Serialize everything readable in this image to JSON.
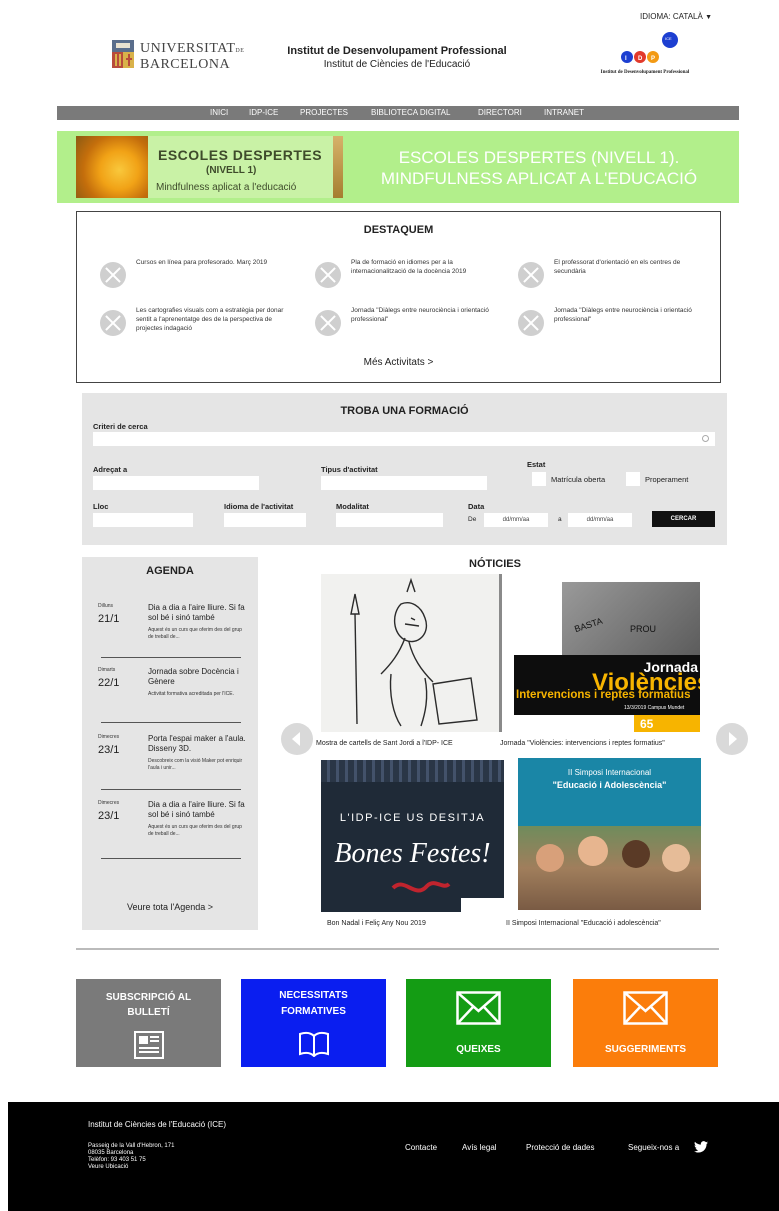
{
  "header": {
    "language": "IDIOMA: CATALÀ",
    "ub_logo": {
      "line1": "UNIVERSITAT",
      "line1_suffix": "DE",
      "line2": "BARCELONA"
    },
    "institute_title": "Institut de Desenvolupament Professional",
    "institute_subtitle": "Institut de Ciències de l'Educació",
    "idp_logo": {
      "letters": [
        "I",
        "D",
        "P"
      ],
      "badge": "ICE",
      "caption": "Institut de Desenvolupament Professional"
    }
  },
  "nav": {
    "items": [
      {
        "label": "INICI"
      },
      {
        "label": "IDP-ICE"
      },
      {
        "label": "PROJECTES"
      },
      {
        "label": "BIBLIOTECA DIGITAL"
      },
      {
        "label": "DIRECTORI"
      },
      {
        "label": "INTRANET"
      }
    ]
  },
  "banner": {
    "image_title": "ESCOLES DESPERTES",
    "image_level": "(NIVELL 1)",
    "image_subtitle": "Mindfulness aplicat a l'educació",
    "title_line1": "ESCOLES DESPERTES (NIVELL 1).",
    "title_line2": "MINDFULNESS APLICAT A L'EDUCACIÓ"
  },
  "featured": {
    "title": "DESTAQUEM",
    "items": [
      {
        "text": "Cursos en línea para profesorado. Març 2019"
      },
      {
        "text": "Pla de formació en idiomes per a la internacionalització de la docència 2019"
      },
      {
        "text": "El professorat d'orientació en els centres de secundària"
      },
      {
        "text": "Les cartografies visuals com a estratègia per donar sentit a l'aprenentatge des de la perspectiva de projectes indagació"
      },
      {
        "text": "Jornada \"Diàlegs entre neurociència i orientació professional\""
      },
      {
        "text": "Jornada \"Diàlegs entre neurociència i orientació professional\""
      }
    ],
    "more": "Més Activitats >"
  },
  "search": {
    "title": "TROBA UNA FORMACIÓ",
    "criteria_label": "Criteri de cerca",
    "addressed_label": "Adreçat a",
    "activity_type_label": "Tipus d'activitat",
    "status_label": "Estat",
    "status_options": [
      "Matrícula oberta",
      "Properament"
    ],
    "place_label": "Lloc",
    "language_label": "Idioma de l'activitat",
    "modality_label": "Modalitat",
    "date_label": "Data",
    "from_label": "De",
    "to_label": "a",
    "date_placeholder": "dd/mm/aa",
    "button": "CERCAR"
  },
  "agenda": {
    "title": "AGENDA",
    "events": [
      {
        "weekday": "Dilluns",
        "date": "21/1",
        "title": "Dia a dia a l'aire lliure. Si fa sol bé i sinó també",
        "desc": "Aquest és un curs que oferim des del grup de treball de..."
      },
      {
        "weekday": "Dimarts",
        "date": "22/1",
        "title": "Jornada sobre Docència i Gènere",
        "desc": "Activitat formativa acreditada per l'ICE."
      },
      {
        "weekday": "Dimecres",
        "date": "23/1",
        "title": "Porta l'espai maker a l'aula. Disseny 3D.",
        "desc": "Descobreix com la visió Maker pot enriquir l'aula i unir..."
      },
      {
        "weekday": "Dimecres",
        "date": "23/1",
        "title": "Dia a dia a l'aire lliure. Si fa sol bé i sinó també",
        "desc": "Aquest és un curs que oferim des del grup de treball de..."
      }
    ],
    "more": "Veure tota l'Agenda >"
  },
  "news": {
    "title": "NÓTICIES",
    "items": [
      {
        "caption": "Mostra de cartells de Sant Jordi a l'IDP- ICE"
      },
      {
        "caption": "Jornada \"Violències: intervencions i reptes formatius\"",
        "image_text": {
          "words": [
            "BASTA",
            "PROU"
          ],
          "title1": "Jornada",
          "title2": "Violències",
          "title3": "Intervencions i reptes formatius",
          "date": "13/3/2019 Campus Mundet",
          "badge": "65"
        }
      },
      {
        "caption": "Bon Nadal i Feliç Any Nou 2019",
        "image_text": {
          "line1": "L'IDP-ICE US DESITJA",
          "line2": "Bones Festes!"
        }
      },
      {
        "caption": "II Simposi Internacional \"Educació i adolescència\"",
        "image_text": {
          "line1": "II Simposi Internacional",
          "line2": "\"Educació i Adolescència\""
        }
      }
    ]
  },
  "tiles": [
    {
      "label_line1": "SUBSCRIPCIÓ AL",
      "label_line2": "BULLETÍ",
      "icon": "newspaper-icon",
      "color": "#7a7a7a"
    },
    {
      "label_line1": "NECESSITATS",
      "label_line2": "FORMATIVES",
      "icon": "book-icon",
      "color": "#0a1ef0"
    },
    {
      "label_line1": "QUEIXES",
      "label_line2": "",
      "icon": "envelope-icon",
      "color": "#149c14"
    },
    {
      "label_line1": "SUGGERIMENTS",
      "label_line2": "",
      "icon": "envelope-icon",
      "color": "#fb7d0b"
    }
  ],
  "footer": {
    "name": "Institut de Ciències de l'Educació (ICE)",
    "address_lines": [
      "Passeig de la Vall d'Hebron, 171",
      "08035 Barcelona",
      "Telèfon: 93 403 51 75",
      "Veure Ubicació"
    ],
    "links": [
      "Contacte",
      "Avís legal",
      "Protecció de dades",
      "Segueix-nos a"
    ],
    "social_icon": "twitter-icon"
  },
  "colors": {
    "nav_bg": "#7a7a7a",
    "banner_bg": "#b2ef8b",
    "panel_bg": "#e5e5e5",
    "footer_bg": "#000000"
  }
}
